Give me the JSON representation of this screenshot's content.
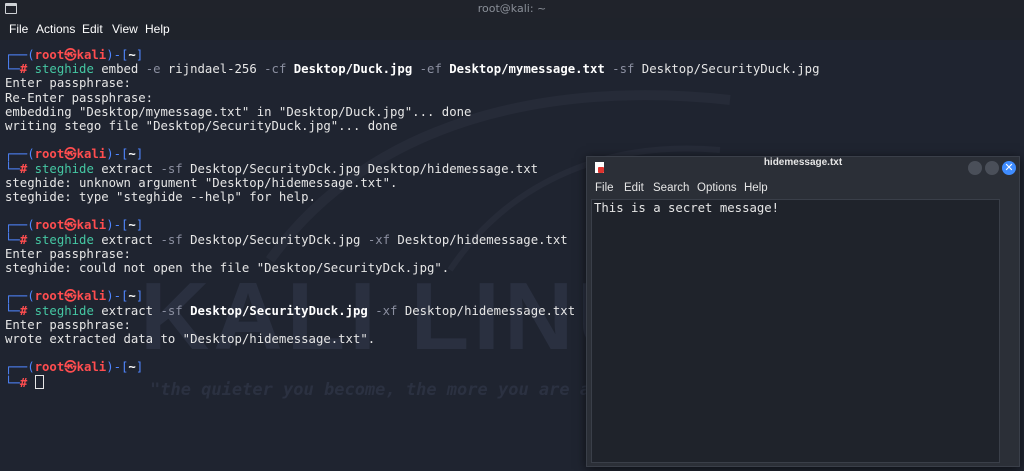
{
  "window": {
    "title": "root@kali: ~",
    "icon": "terminal-icon"
  },
  "menubar": [
    "File",
    "Actions",
    "Edit",
    "View",
    "Help"
  ],
  "watermark": {
    "logo": "KALI LINUX",
    "slogan": "\"the quieter you become, the more you are able to hear\""
  },
  "prompt": {
    "top_open": "┌──(",
    "user": "root",
    "at_symbol": "㉿",
    "host": "kali",
    "close_open": ")-[",
    "dir": "~",
    "close": "]",
    "bottom": "└─",
    "hash": "# "
  },
  "blocks": [
    {
      "command": {
        "name": "steghide",
        "parts": [
          {
            "t": " embed ",
            "s": "plain"
          },
          {
            "t": "-e",
            "s": "opt"
          },
          {
            "t": " rijndael-256 ",
            "s": "plain"
          },
          {
            "t": "-cf",
            "s": "opt"
          },
          {
            "t": " ",
            "s": "plain"
          },
          {
            "t": "Desktop/Duck.jpg",
            "s": "bold"
          },
          {
            "t": " ",
            "s": "plain"
          },
          {
            "t": "-ef",
            "s": "opt"
          },
          {
            "t": " ",
            "s": "plain"
          },
          {
            "t": "Desktop/mymessage.txt",
            "s": "bold"
          },
          {
            "t": " ",
            "s": "plain"
          },
          {
            "t": "-sf",
            "s": "opt"
          },
          {
            "t": " Desktop/SecurityDuck.jpg",
            "s": "plain"
          }
        ]
      },
      "output": [
        "Enter passphrase:",
        "Re-Enter passphrase:",
        "embedding \"Desktop/mymessage.txt\" in \"Desktop/Duck.jpg\"... done",
        "writing stego file \"Desktop/SecurityDuck.jpg\"... done"
      ]
    },
    {
      "command": {
        "name": "steghide",
        "parts": [
          {
            "t": " extract ",
            "s": "plain"
          },
          {
            "t": "-sf",
            "s": "opt"
          },
          {
            "t": " Desktop/SecurityDck.jpg Desktop/hidemessage.txt",
            "s": "plain"
          }
        ]
      },
      "output": [
        "steghide: unknown argument \"Desktop/hidemessage.txt\".",
        "steghide: type \"steghide --help\" for help."
      ]
    },
    {
      "command": {
        "name": "steghide",
        "parts": [
          {
            "t": " extract ",
            "s": "plain"
          },
          {
            "t": "-sf",
            "s": "opt"
          },
          {
            "t": " Desktop/SecurityDck.jpg ",
            "s": "plain"
          },
          {
            "t": "-xf",
            "s": "opt"
          },
          {
            "t": " Desktop/hidemessage.txt",
            "s": "plain"
          }
        ]
      },
      "output": [
        "Enter passphrase:",
        "steghide: could not open the file \"Desktop/SecurityDck.jpg\"."
      ]
    },
    {
      "command": {
        "name": "steghide",
        "parts": [
          {
            "t": " extract ",
            "s": "plain"
          },
          {
            "t": "-sf",
            "s": "opt"
          },
          {
            "t": " ",
            "s": "plain"
          },
          {
            "t": "Desktop/SecurityDuck.jpg",
            "s": "bold"
          },
          {
            "t": " ",
            "s": "plain"
          },
          {
            "t": "-xf",
            "s": "opt"
          },
          {
            "t": " Desktop/hidemessage.txt",
            "s": "plain"
          }
        ]
      },
      "output": [
        "Enter passphrase:",
        "wrote extracted data to \"Desktop/hidemessage.txt\"."
      ]
    },
    {
      "command": null,
      "output": []
    }
  ],
  "editor": {
    "title": "hidemessage.txt",
    "menu": [
      "File",
      "Edit",
      "Search",
      "Options",
      "Help"
    ],
    "content": "This is a secret message!",
    "close_glyph": "✕"
  },
  "colors": {
    "prompt_frame": "#4f86ff",
    "prompt_user": "#ff4d4f",
    "command": "#45c7a3",
    "option": "#8b8fa0",
    "background": "#1f2430",
    "accent": "#3f8cff"
  }
}
